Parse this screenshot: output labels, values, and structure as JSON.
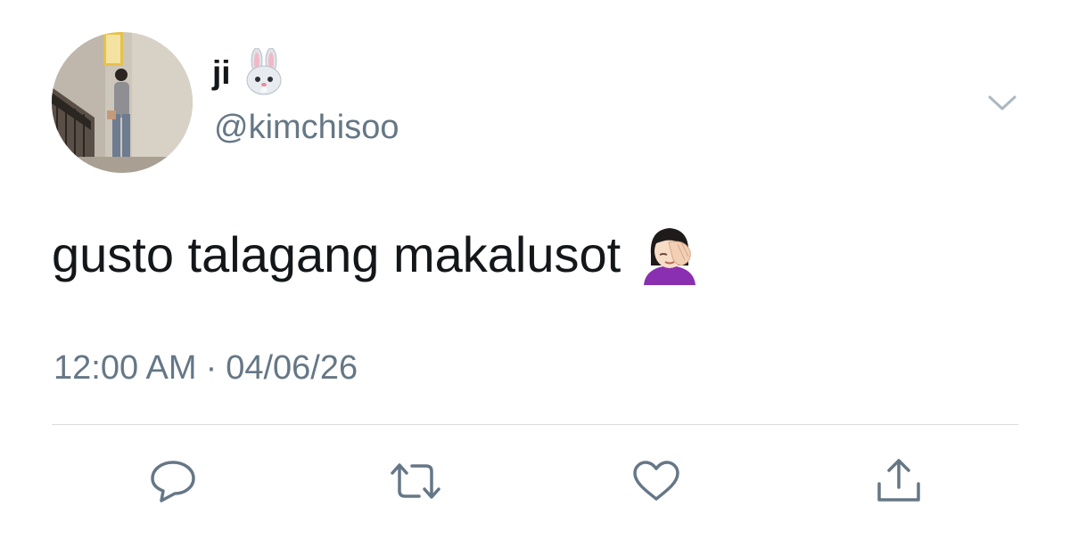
{
  "user": {
    "display_name": "ji",
    "name_emoji": "rabbit-face-emoji",
    "handle": "@kimchisoo",
    "avatar": "profile-photo"
  },
  "tweet": {
    "text": "gusto talagang makalusot",
    "text_emoji": "woman-facepalming-emoji",
    "time": "12:00 AM",
    "separator": "·",
    "date": "04/06/26"
  },
  "actions": [
    {
      "icon": "reply-icon"
    },
    {
      "icon": "retweet-icon"
    },
    {
      "icon": "like-icon"
    },
    {
      "icon": "share-icon"
    }
  ],
  "colors": {
    "text_primary": "#14171a",
    "text_secondary": "#657786",
    "icon": "#657786",
    "divider": "#d9dee3"
  }
}
